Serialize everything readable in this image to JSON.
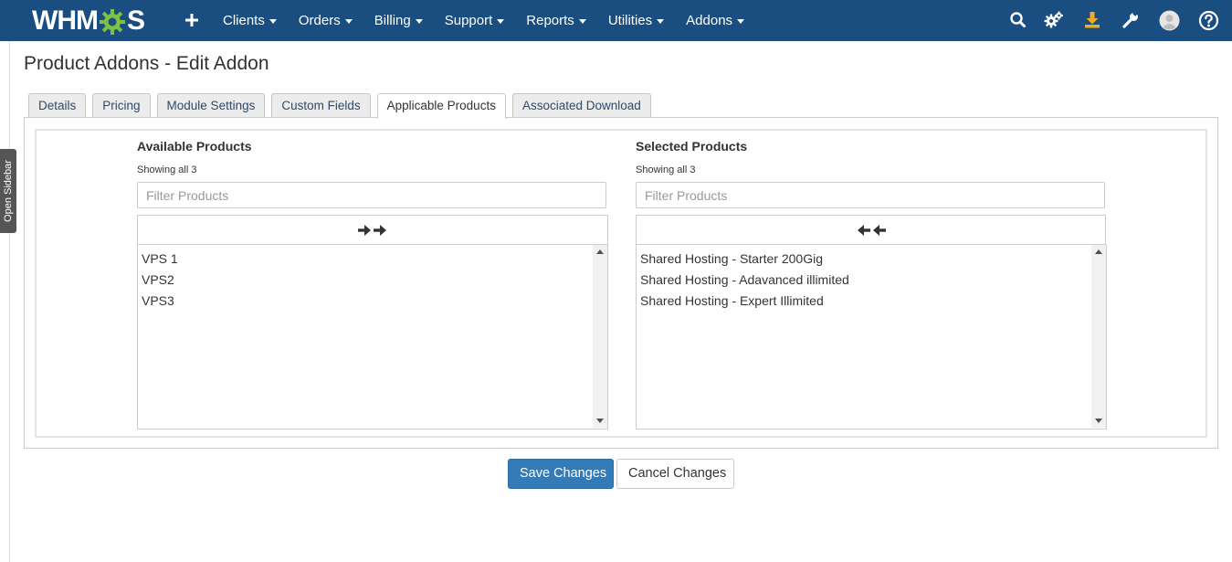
{
  "app": {
    "logo_text_left": "WHM",
    "logo_text_right": "S"
  },
  "nav": {
    "items": [
      {
        "label": "Clients"
      },
      {
        "label": "Orders"
      },
      {
        "label": "Billing"
      },
      {
        "label": "Support"
      },
      {
        "label": "Reports"
      },
      {
        "label": "Utilities"
      },
      {
        "label": "Addons"
      }
    ],
    "icons": [
      "search-icon",
      "gears-icon",
      "download-icon",
      "wrench-icon",
      "user-avatar-icon",
      "help-icon"
    ]
  },
  "sidebar": {
    "open_label": "Open Sidebar"
  },
  "page": {
    "title": "Product Addons - Edit Addon"
  },
  "tabs": [
    {
      "label": "Details"
    },
    {
      "label": "Pricing"
    },
    {
      "label": "Module Settings"
    },
    {
      "label": "Custom Fields"
    },
    {
      "label": "Applicable Products"
    },
    {
      "label": "Associated Download"
    }
  ],
  "active_tab": "Applicable Products",
  "available": {
    "heading": "Available Products",
    "count_text": "Showing all 3",
    "filter_placeholder": "Filter Products",
    "items": [
      "VPS 1",
      "VPS2",
      "VPS3"
    ]
  },
  "selected": {
    "heading": "Selected Products",
    "count_text": "Showing all 3",
    "filter_placeholder": "Filter Products",
    "items": [
      "Shared Hosting - Starter 200Gig",
      "Shared Hosting - Adavanced illimited",
      "Shared Hosting - Expert Illimited"
    ]
  },
  "buttons": {
    "save": "Save Changes",
    "cancel": "Cancel Changes"
  },
  "colors": {
    "nav_bg": "#1a4d80",
    "logo_gear": "#7dc242",
    "primary_button": "#337ab7",
    "download_icon": "#f0ad1e"
  }
}
